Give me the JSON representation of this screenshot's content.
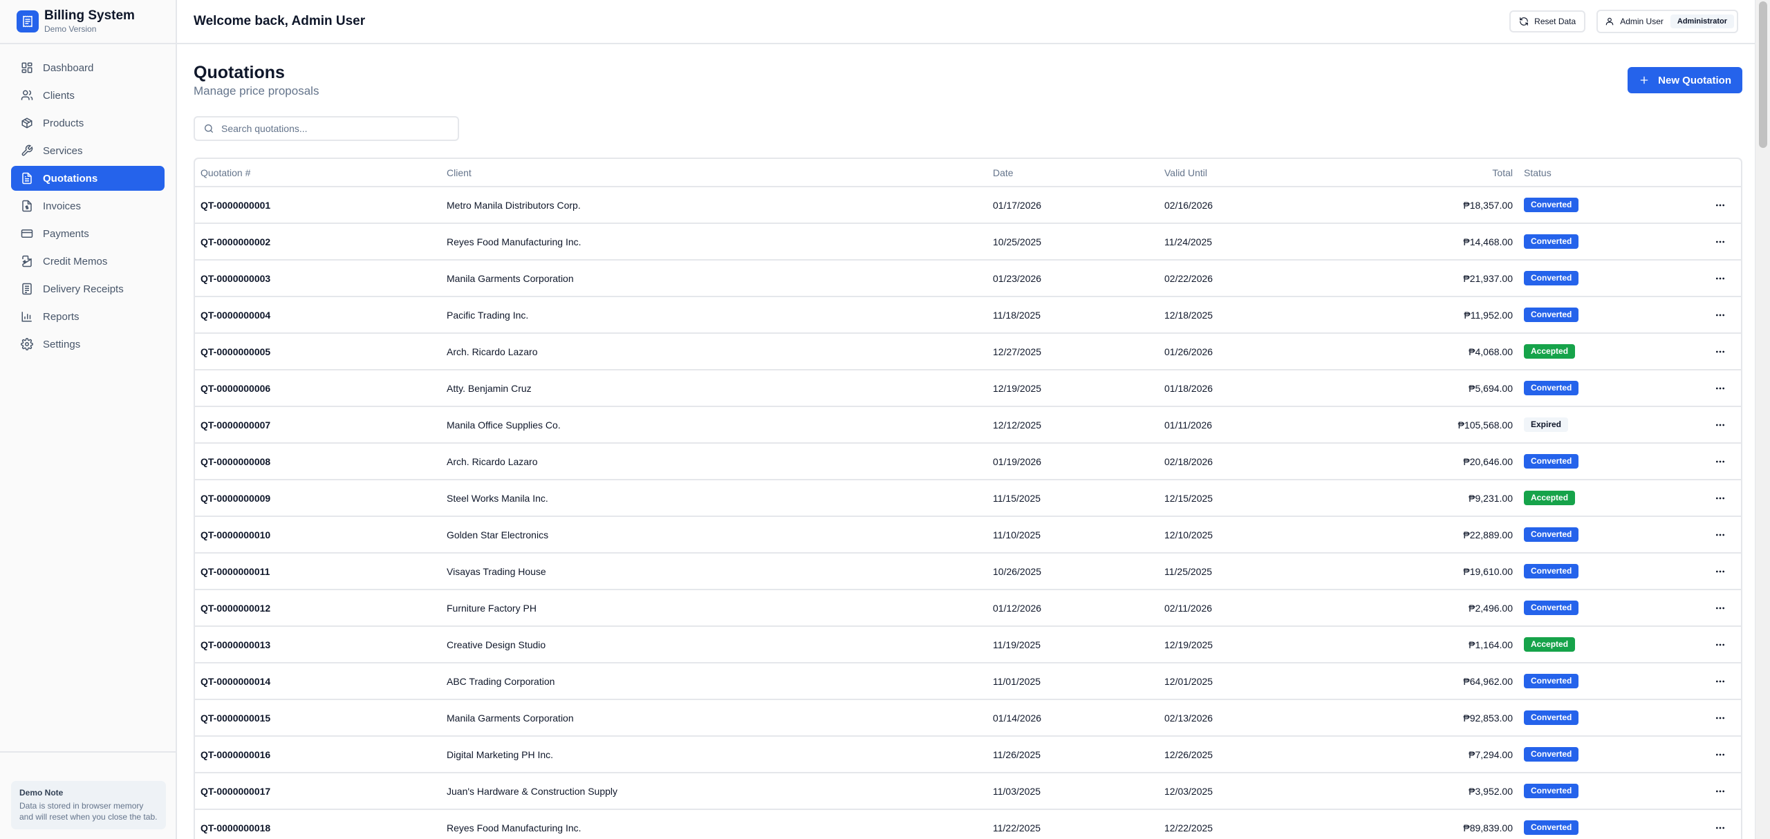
{
  "brand": {
    "title": "Billing System",
    "subtitle": "Demo Version"
  },
  "sidebar": {
    "items": [
      {
        "label": "Dashboard",
        "icon": "layout-dashboard-icon"
      },
      {
        "label": "Clients",
        "icon": "users-icon"
      },
      {
        "label": "Products",
        "icon": "package-icon"
      },
      {
        "label": "Services",
        "icon": "wrench-icon"
      },
      {
        "label": "Quotations",
        "icon": "file-text-icon",
        "active": true
      },
      {
        "label": "Invoices",
        "icon": "file-dollar-icon"
      },
      {
        "label": "Payments",
        "icon": "credit-card-icon"
      },
      {
        "label": "Credit Memos",
        "icon": "file-return-icon"
      },
      {
        "label": "Delivery Receipts",
        "icon": "receipt-icon"
      },
      {
        "label": "Reports",
        "icon": "bar-chart-icon"
      },
      {
        "label": "Settings",
        "icon": "gear-icon"
      }
    ],
    "note": {
      "title": "Demo Note",
      "text": "Data is stored in browser memory and will reset when you close the tab."
    }
  },
  "header": {
    "welcome": "Welcome back, Admin User",
    "reset_label": "Reset Data",
    "user_name": "Admin User",
    "user_role": "Administrator"
  },
  "page": {
    "title": "Quotations",
    "subtitle": "Manage price proposals",
    "new_button": "New Quotation",
    "search_placeholder": "Search quotations..."
  },
  "colors": {
    "accent": "#2563eb",
    "accepted": "#16a34a",
    "expired_bg": "#f1f5f9"
  },
  "table": {
    "columns": [
      "Quotation #",
      "Client",
      "Date",
      "Valid Until",
      "Total",
      "Status"
    ],
    "rows": [
      [
        "QT-0000000001",
        "Metro Manila Distributors Corp.",
        "01/17/2026",
        "02/16/2026",
        "₱18,357.00",
        "Converted"
      ],
      [
        "QT-0000000002",
        "Reyes Food Manufacturing Inc.",
        "10/25/2025",
        "11/24/2025",
        "₱14,468.00",
        "Converted"
      ],
      [
        "QT-0000000003",
        "Manila Garments Corporation",
        "01/23/2026",
        "02/22/2026",
        "₱21,937.00",
        "Converted"
      ],
      [
        "QT-0000000004",
        "Pacific Trading Inc.",
        "11/18/2025",
        "12/18/2025",
        "₱11,952.00",
        "Converted"
      ],
      [
        "QT-0000000005",
        "Arch. Ricardo Lazaro",
        "12/27/2025",
        "01/26/2026",
        "₱4,068.00",
        "Accepted"
      ],
      [
        "QT-0000000006",
        "Atty. Benjamin Cruz",
        "12/19/2025",
        "01/18/2026",
        "₱5,694.00",
        "Converted"
      ],
      [
        "QT-0000000007",
        "Manila Office Supplies Co.",
        "12/12/2025",
        "01/11/2026",
        "₱105,568.00",
        "Expired"
      ],
      [
        "QT-0000000008",
        "Arch. Ricardo Lazaro",
        "01/19/2026",
        "02/18/2026",
        "₱20,646.00",
        "Converted"
      ],
      [
        "QT-0000000009",
        "Steel Works Manila Inc.",
        "11/15/2025",
        "12/15/2025",
        "₱9,231.00",
        "Accepted"
      ],
      [
        "QT-0000000010",
        "Golden Star Electronics",
        "11/10/2025",
        "12/10/2025",
        "₱22,889.00",
        "Converted"
      ],
      [
        "QT-0000000011",
        "Visayas Trading House",
        "10/26/2025",
        "11/25/2025",
        "₱19,610.00",
        "Converted"
      ],
      [
        "QT-0000000012",
        "Furniture Factory PH",
        "01/12/2026",
        "02/11/2026",
        "₱2,496.00",
        "Converted"
      ],
      [
        "QT-0000000013",
        "Creative Design Studio",
        "11/19/2025",
        "12/19/2025",
        "₱1,164.00",
        "Accepted"
      ],
      [
        "QT-0000000014",
        "ABC Trading Corporation",
        "11/01/2025",
        "12/01/2025",
        "₱64,962.00",
        "Converted"
      ],
      [
        "QT-0000000015",
        "Manila Garments Corporation",
        "01/14/2026",
        "02/13/2026",
        "₱92,853.00",
        "Converted"
      ],
      [
        "QT-0000000016",
        "Digital Marketing PH Inc.",
        "11/26/2025",
        "12/26/2025",
        "₱7,294.00",
        "Converted"
      ],
      [
        "QT-0000000017",
        "Juan's Hardware & Construction Supply",
        "11/03/2025",
        "12/03/2025",
        "₱3,952.00",
        "Converted"
      ],
      [
        "QT-0000000018",
        "Reyes Food Manufacturing Inc.",
        "11/22/2025",
        "12/22/2025",
        "₱89,839.00",
        "Converted"
      ]
    ]
  }
}
